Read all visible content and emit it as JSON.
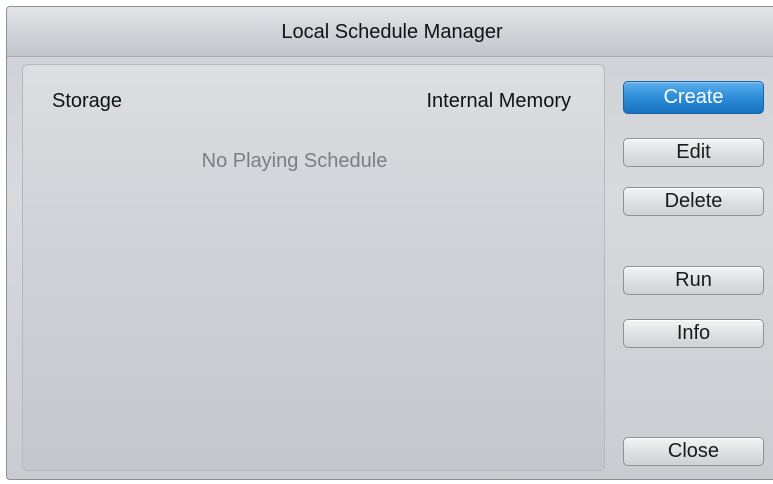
{
  "window": {
    "title": "Local Schedule Manager"
  },
  "panel": {
    "storage_label": "Storage",
    "storage_value": "Internal Memory",
    "empty_message": "No Playing Schedule"
  },
  "buttons": {
    "create": "Create",
    "edit": "Edit",
    "delete": "Delete",
    "run": "Run",
    "info": "Info",
    "close": "Close"
  },
  "colors": {
    "primary_button": "#2b8cd8",
    "panel_background": "#cfd2d6",
    "disabled_text": "#7b7e82"
  }
}
